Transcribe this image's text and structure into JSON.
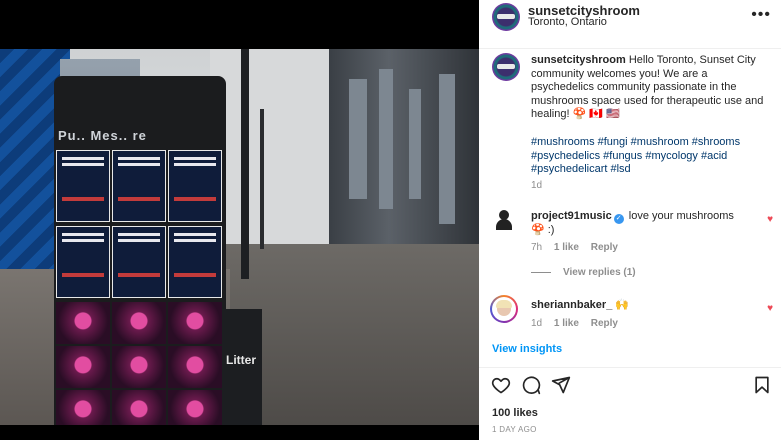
{
  "post": {
    "username": "sunsetcityshroom",
    "location": "Toronto, Ontario",
    "more_icon": "more-horizontal-icon"
  },
  "photo": {
    "sign_text": "Pu.. Mes.. re",
    "bin_label": "Litter"
  },
  "caption": {
    "username": "sunsetcityshroom",
    "text": "Hello Toronto, Sunset City community welcomes you! We are a psychedelics community passionate in the mushrooms space used for therapeutic use and healing! 🍄 🇨🇦 🇺🇸",
    "hashtags": "#mushrooms #fungi #mushroom #shrooms #psychedelics #fungus #mycology #acid #psychedelicart #lsd",
    "age": "1d"
  },
  "comments": [
    {
      "username": "project91music",
      "verified": true,
      "text": "love your mushrooms 🍄 :)",
      "age": "7h",
      "likes": "1 like",
      "reply": "Reply",
      "view_replies": "View replies (1)"
    },
    {
      "username": "sheriannbaker_",
      "text": "🙌",
      "age": "1d",
      "likes": "1 like",
      "reply": "Reply"
    }
  ],
  "view_insights": "View insights",
  "actions": [
    "heart-icon",
    "comment-icon",
    "share-icon",
    "bookmark-icon"
  ],
  "likes_count": "100 likes",
  "date": "1 DAY AGO",
  "colors": {
    "link": "#00376b",
    "accent": "#0095f6",
    "heart": "#ed4956",
    "muted": "#8e8e8e"
  }
}
